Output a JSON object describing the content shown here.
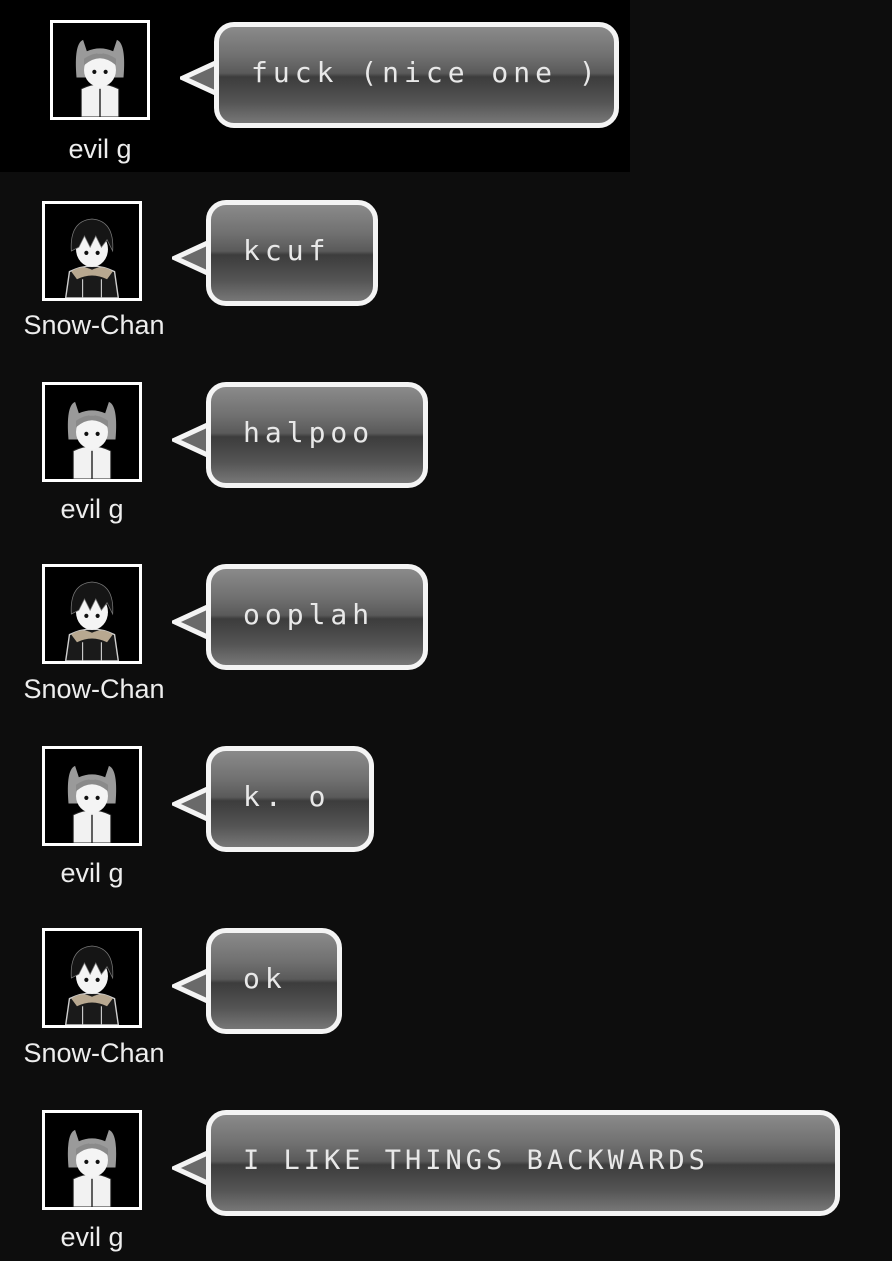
{
  "messages": [
    {
      "user": "evil g",
      "avatar": "girl-cat-ears-avatar",
      "text": "fuck (nice one )"
    },
    {
      "user": "Snow-Chan",
      "avatar": "boy-dark-hair-avatar",
      "text": "kcuf"
    },
    {
      "user": "evil g",
      "avatar": "girl-cat-ears-avatar",
      "text": "halpoo"
    },
    {
      "user": "Snow-Chan",
      "avatar": "boy-dark-hair-avatar",
      "text": "ooplah"
    },
    {
      "user": "evil g",
      "avatar": "girl-cat-ears-avatar",
      "text": "k. o"
    },
    {
      "user": "Snow-Chan",
      "avatar": "boy-dark-hair-avatar",
      "text": "ok"
    },
    {
      "user": "evil g",
      "avatar": "girl-cat-ears-avatar",
      "text": "I LIKE THINGS BACKWARDS"
    }
  ],
  "colors": {
    "background": "#0d0d0d",
    "bubble_border": "#f4f4f4",
    "username_text": "#ededed"
  }
}
